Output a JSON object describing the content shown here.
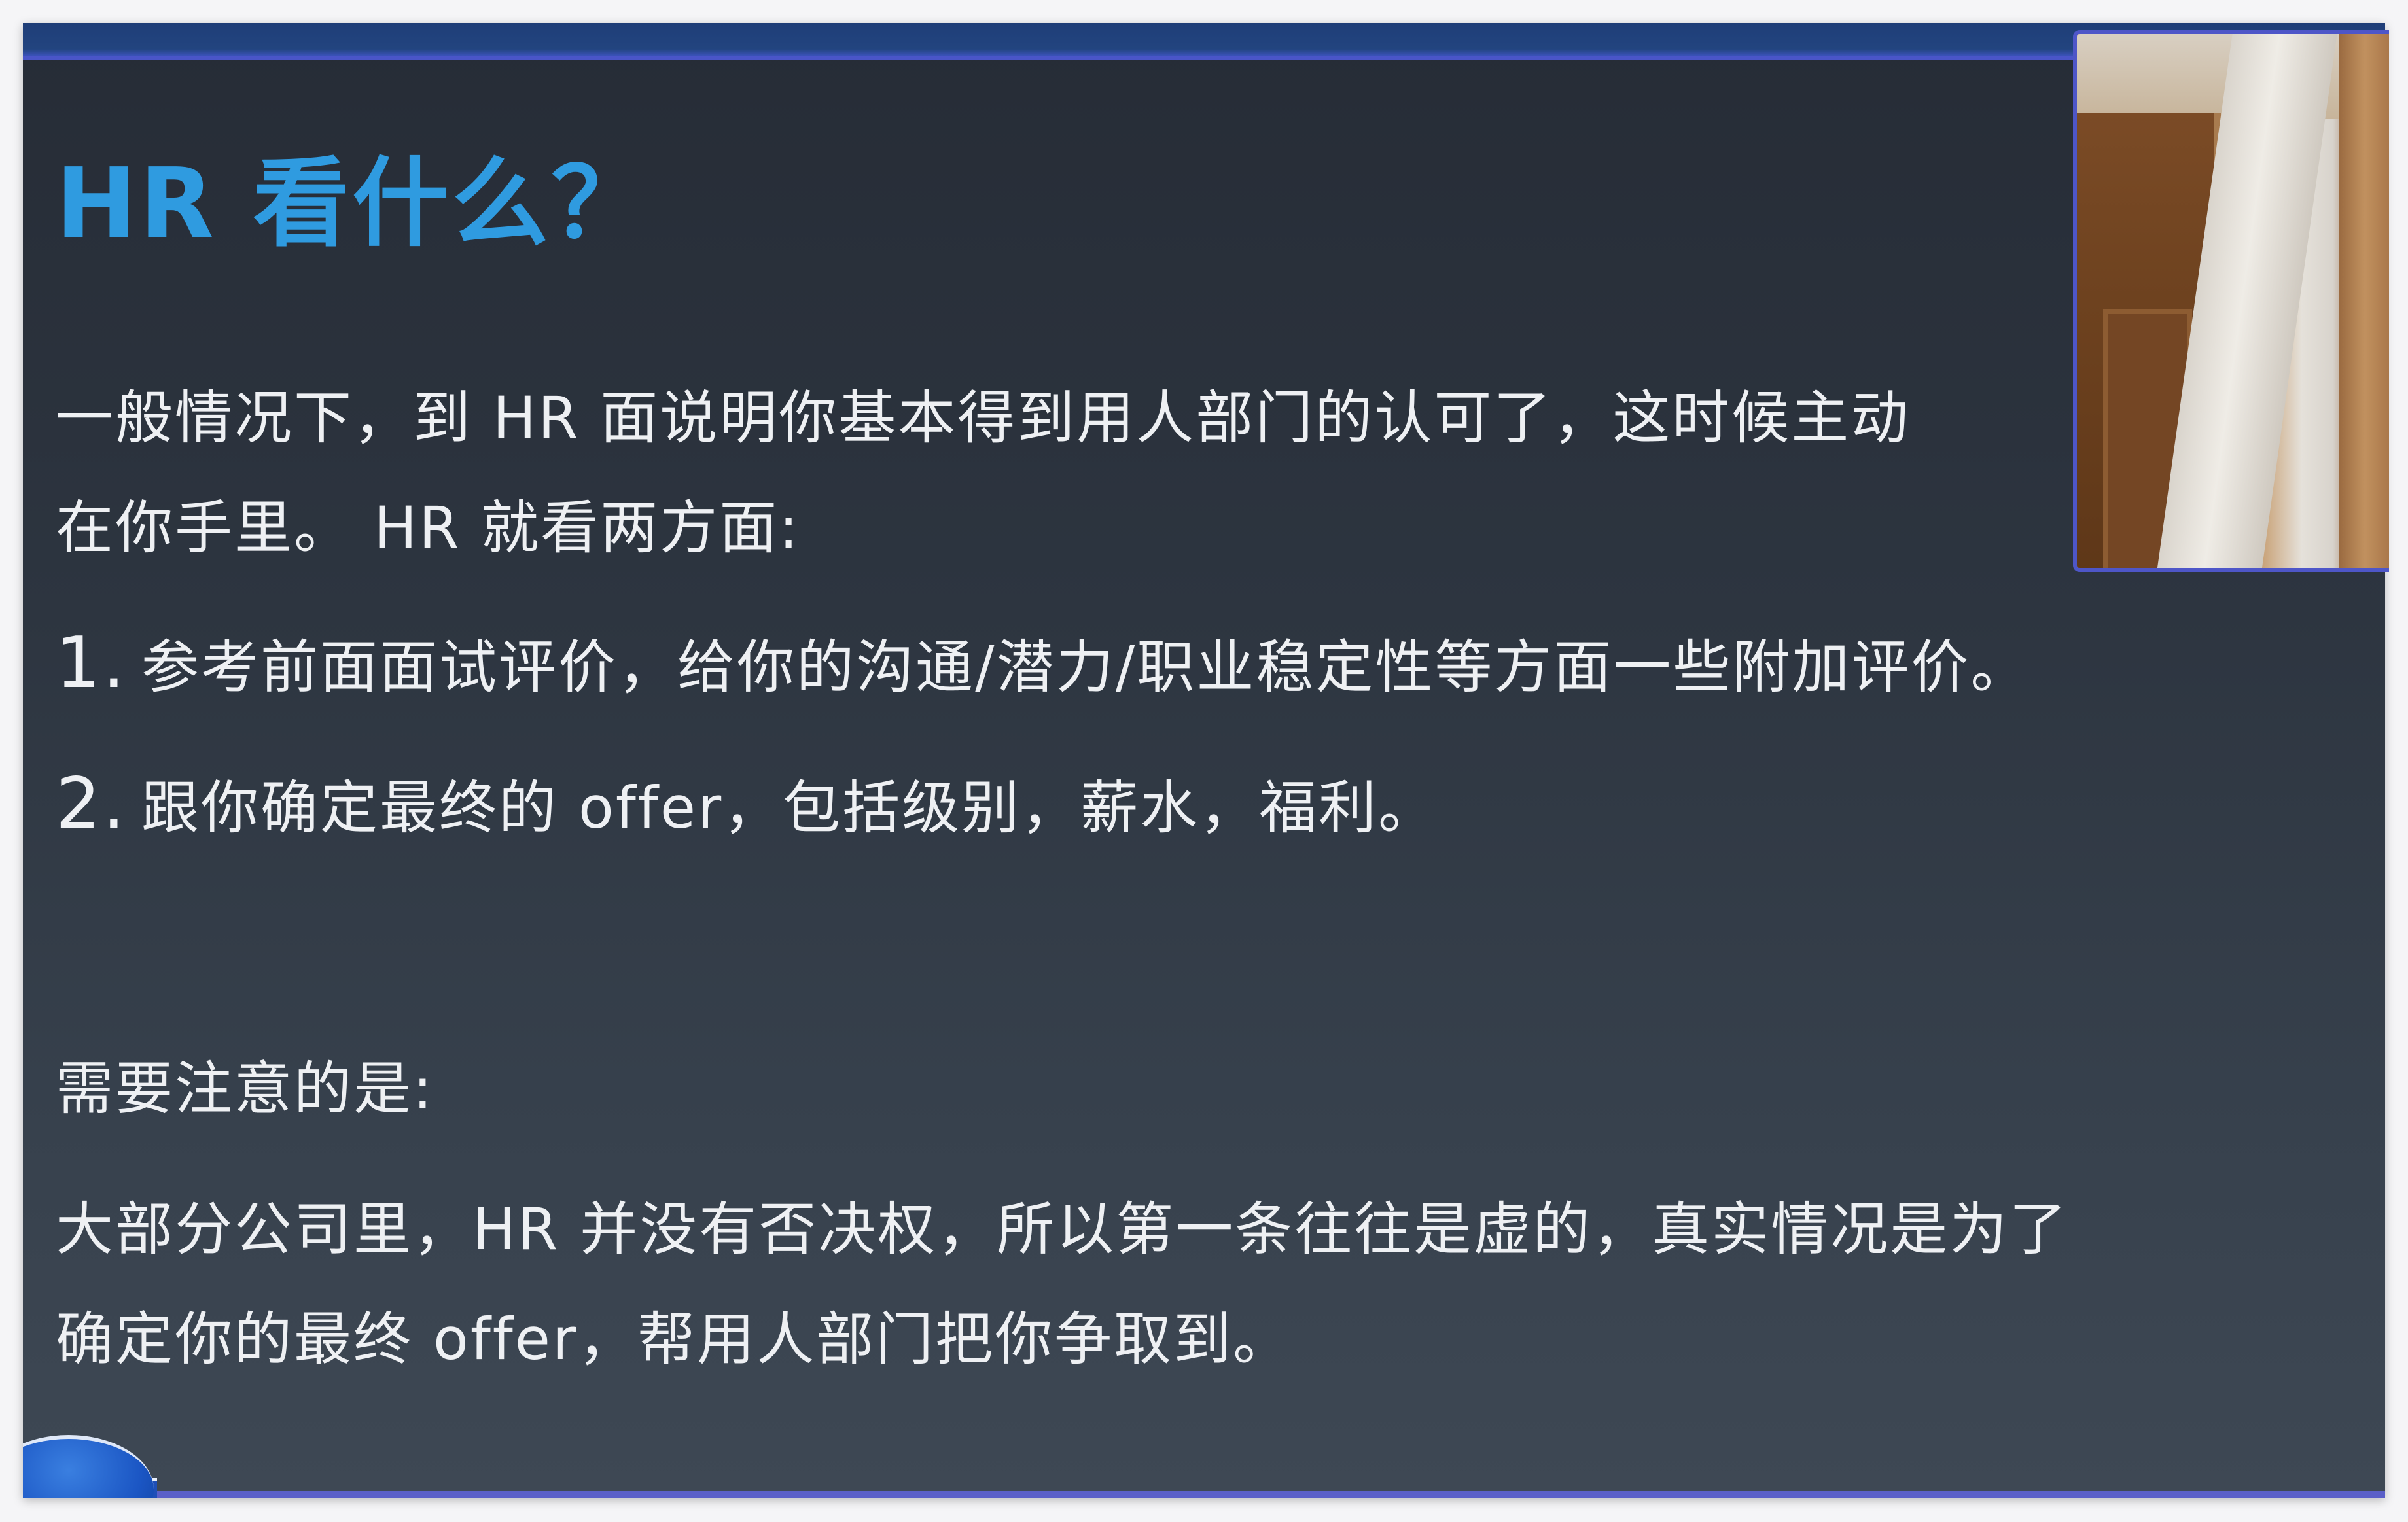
{
  "slide": {
    "title": "HR 看什么？",
    "intro_lines": [
      "一般情况下，到 HR 面说明你基本得到用人部门的认可了，这时候主动",
      "在你手里。 HR 就看两方面:"
    ],
    "items": [
      {
        "num": "1.",
        "text": "参考前面面试评价，给你的沟通/潜力/职业稳定性等方面一些附加评价。"
      },
      {
        "num": "2.",
        "text": "跟你确定最终的 offer，包括级别，薪水，福利。"
      }
    ],
    "note_title": "需要注意的是:",
    "note_lines": [
      "大部分公司里，HR 并没有否决权，所以第一条往往是虚的，真实情况是为了",
      "确定你的最终 offer，帮用人部门把你争取到。"
    ]
  },
  "colors": {
    "title": "#2f9be0",
    "body_text": "#eef0f3",
    "accent_bar": "#4a55c8",
    "slide_bg": "#2d3540"
  },
  "webcam": {
    "icon": "webcam-video-feed"
  }
}
